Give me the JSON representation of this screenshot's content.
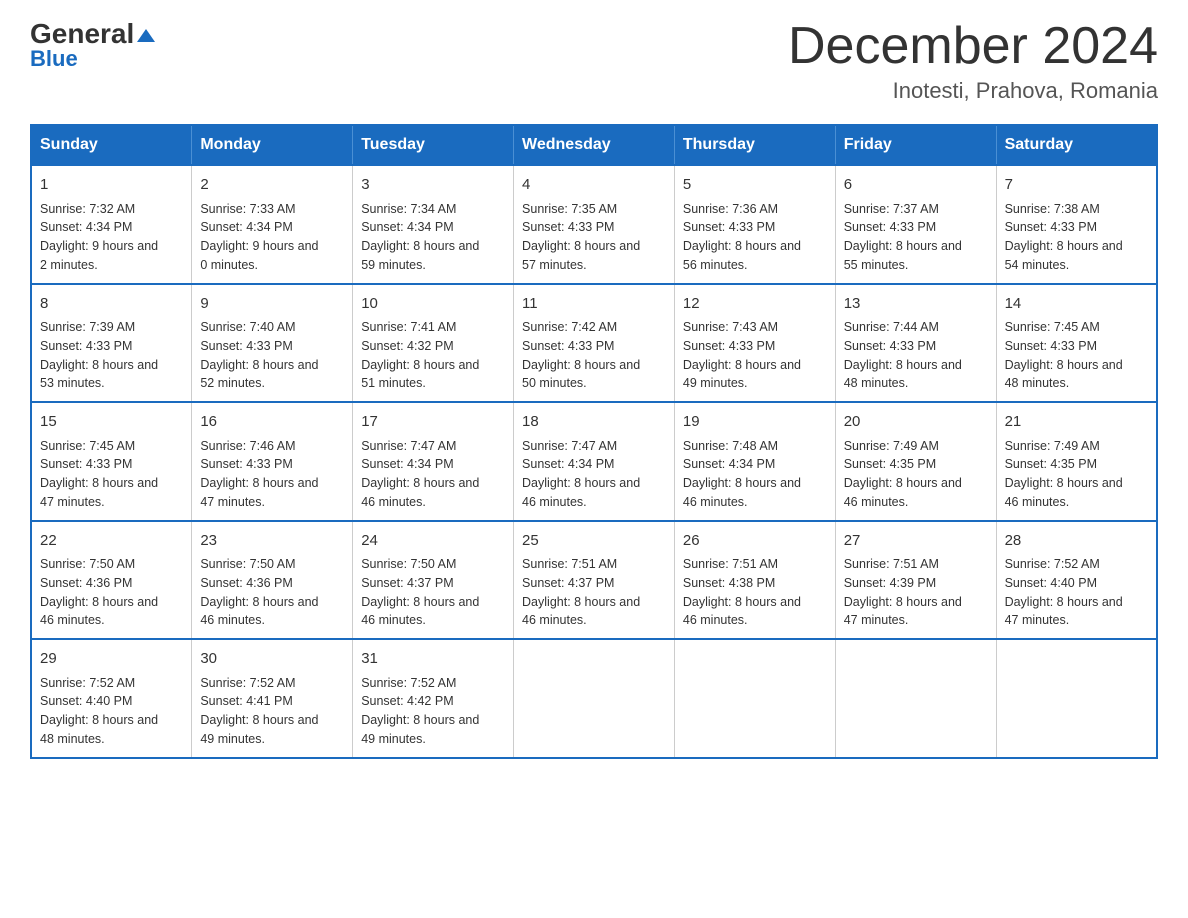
{
  "logo": {
    "top": "General",
    "arrow": "▲",
    "bottom": "Blue"
  },
  "title": "December 2024",
  "subtitle": "Inotesti, Prahova, Romania",
  "days_header": [
    "Sunday",
    "Monday",
    "Tuesday",
    "Wednesday",
    "Thursday",
    "Friday",
    "Saturday"
  ],
  "weeks": [
    [
      {
        "day": "1",
        "sunrise": "7:32 AM",
        "sunset": "4:34 PM",
        "daylight": "9 hours and 2 minutes."
      },
      {
        "day": "2",
        "sunrise": "7:33 AM",
        "sunset": "4:34 PM",
        "daylight": "9 hours and 0 minutes."
      },
      {
        "day": "3",
        "sunrise": "7:34 AM",
        "sunset": "4:34 PM",
        "daylight": "8 hours and 59 minutes."
      },
      {
        "day": "4",
        "sunrise": "7:35 AM",
        "sunset": "4:33 PM",
        "daylight": "8 hours and 57 minutes."
      },
      {
        "day": "5",
        "sunrise": "7:36 AM",
        "sunset": "4:33 PM",
        "daylight": "8 hours and 56 minutes."
      },
      {
        "day": "6",
        "sunrise": "7:37 AM",
        "sunset": "4:33 PM",
        "daylight": "8 hours and 55 minutes."
      },
      {
        "day": "7",
        "sunrise": "7:38 AM",
        "sunset": "4:33 PM",
        "daylight": "8 hours and 54 minutes."
      }
    ],
    [
      {
        "day": "8",
        "sunrise": "7:39 AM",
        "sunset": "4:33 PM",
        "daylight": "8 hours and 53 minutes."
      },
      {
        "day": "9",
        "sunrise": "7:40 AM",
        "sunset": "4:33 PM",
        "daylight": "8 hours and 52 minutes."
      },
      {
        "day": "10",
        "sunrise": "7:41 AM",
        "sunset": "4:32 PM",
        "daylight": "8 hours and 51 minutes."
      },
      {
        "day": "11",
        "sunrise": "7:42 AM",
        "sunset": "4:33 PM",
        "daylight": "8 hours and 50 minutes."
      },
      {
        "day": "12",
        "sunrise": "7:43 AM",
        "sunset": "4:33 PM",
        "daylight": "8 hours and 49 minutes."
      },
      {
        "day": "13",
        "sunrise": "7:44 AM",
        "sunset": "4:33 PM",
        "daylight": "8 hours and 48 minutes."
      },
      {
        "day": "14",
        "sunrise": "7:45 AM",
        "sunset": "4:33 PM",
        "daylight": "8 hours and 48 minutes."
      }
    ],
    [
      {
        "day": "15",
        "sunrise": "7:45 AM",
        "sunset": "4:33 PM",
        "daylight": "8 hours and 47 minutes."
      },
      {
        "day": "16",
        "sunrise": "7:46 AM",
        "sunset": "4:33 PM",
        "daylight": "8 hours and 47 minutes."
      },
      {
        "day": "17",
        "sunrise": "7:47 AM",
        "sunset": "4:34 PM",
        "daylight": "8 hours and 46 minutes."
      },
      {
        "day": "18",
        "sunrise": "7:47 AM",
        "sunset": "4:34 PM",
        "daylight": "8 hours and 46 minutes."
      },
      {
        "day": "19",
        "sunrise": "7:48 AM",
        "sunset": "4:34 PM",
        "daylight": "8 hours and 46 minutes."
      },
      {
        "day": "20",
        "sunrise": "7:49 AM",
        "sunset": "4:35 PM",
        "daylight": "8 hours and 46 minutes."
      },
      {
        "day": "21",
        "sunrise": "7:49 AM",
        "sunset": "4:35 PM",
        "daylight": "8 hours and 46 minutes."
      }
    ],
    [
      {
        "day": "22",
        "sunrise": "7:50 AM",
        "sunset": "4:36 PM",
        "daylight": "8 hours and 46 minutes."
      },
      {
        "day": "23",
        "sunrise": "7:50 AM",
        "sunset": "4:36 PM",
        "daylight": "8 hours and 46 minutes."
      },
      {
        "day": "24",
        "sunrise": "7:50 AM",
        "sunset": "4:37 PM",
        "daylight": "8 hours and 46 minutes."
      },
      {
        "day": "25",
        "sunrise": "7:51 AM",
        "sunset": "4:37 PM",
        "daylight": "8 hours and 46 minutes."
      },
      {
        "day": "26",
        "sunrise": "7:51 AM",
        "sunset": "4:38 PM",
        "daylight": "8 hours and 46 minutes."
      },
      {
        "day": "27",
        "sunrise": "7:51 AM",
        "sunset": "4:39 PM",
        "daylight": "8 hours and 47 minutes."
      },
      {
        "day": "28",
        "sunrise": "7:52 AM",
        "sunset": "4:40 PM",
        "daylight": "8 hours and 47 minutes."
      }
    ],
    [
      {
        "day": "29",
        "sunrise": "7:52 AM",
        "sunset": "4:40 PM",
        "daylight": "8 hours and 48 minutes."
      },
      {
        "day": "30",
        "sunrise": "7:52 AM",
        "sunset": "4:41 PM",
        "daylight": "8 hours and 49 minutes."
      },
      {
        "day": "31",
        "sunrise": "7:52 AM",
        "sunset": "4:42 PM",
        "daylight": "8 hours and 49 minutes."
      },
      null,
      null,
      null,
      null
    ]
  ]
}
